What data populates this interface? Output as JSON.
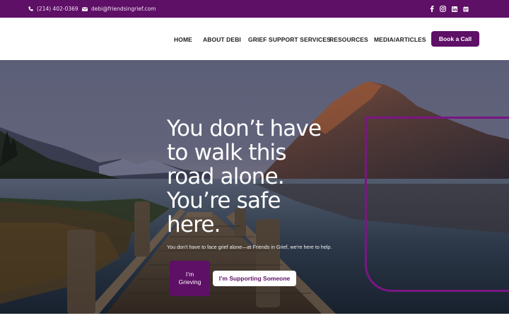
{
  "topbar": {
    "phone": "(214) 402-0369",
    "email": "debi@friendsingrief.com",
    "social_icons": [
      "facebook-icon",
      "instagram-icon",
      "linkedin-icon",
      "calendar-icon"
    ]
  },
  "nav": {
    "items": [
      {
        "label": "HOME"
      },
      {
        "label": "ABOUT DEBI"
      },
      {
        "label": "GRIEF SUPPORT SERVICES"
      },
      {
        "label": "RESOURCES"
      },
      {
        "label": "MEDIA/ARTICLES"
      }
    ],
    "cta": "Book a Call"
  },
  "hero": {
    "headline": "You don’t have to walk this road alone. You’re safe here.",
    "subtext": "You don't have to face grief alone—at Friends in Grief, we're here to help.",
    "primary_button": "I’m Grieving",
    "secondary_button": "I’m Supporting Someone"
  },
  "colors": {
    "brand_purple": "#5e0f66",
    "accent_purple": "#7a1684",
    "white": "#ffffff"
  }
}
